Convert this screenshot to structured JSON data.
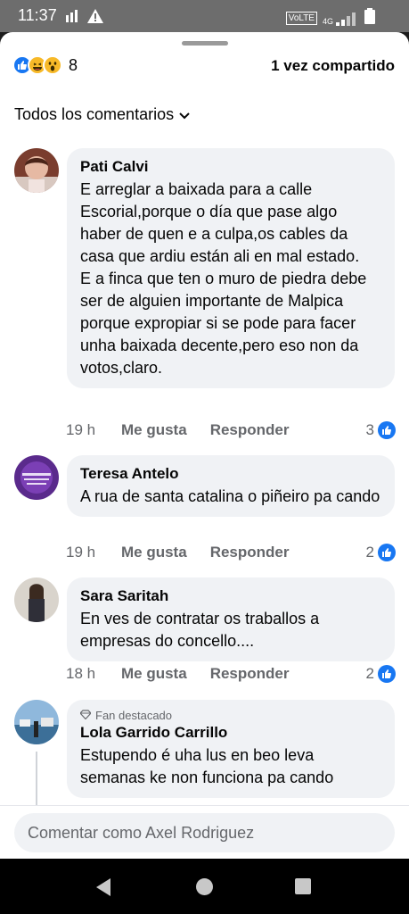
{
  "status_bar": {
    "time": "11:37",
    "network_label": "VoLTE",
    "signal_label": "4G"
  },
  "reactions": {
    "types": [
      "like-icon",
      "haha-icon",
      "wow-icon"
    ],
    "count": "8"
  },
  "shares_text": "1 vez compartido",
  "filter_label": "Todos los comentarios",
  "comments": [
    {
      "author": "Pati Calvi",
      "lines": [
        "E arreglar a baixada para a calle Escorial,porque o día que pase algo haber de quen e a culpa,os cables da casa que ardiu están ali en mal estado.",
        "E a finca que ten o muro de piedra debe ser de alguien importante de Malpica porque expropiar si se pode para facer unha baixada decente,pero eso non da votos,claro."
      ],
      "time": "19 h",
      "like_label": "Me gusta",
      "reply_label": "Responder",
      "likes": "3"
    },
    {
      "author": "Teresa Antelo",
      "lines": [
        "A rua de santa catalina o piñeiro pa cando"
      ],
      "time": "19 h",
      "like_label": "Me gusta",
      "reply_label": "Responder",
      "likes": "2"
    },
    {
      "author": "Sara Saritah",
      "lines": [
        "En ves de contratar os traballos a empresas do concello...."
      ],
      "time": "18 h",
      "like_label": "Me gusta",
      "reply_label": "Responder",
      "likes": "2"
    },
    {
      "badge": "Fan destacado",
      "author": "Lola Garrido Carrillo",
      "lines": [
        "Estupendo é uha lus en beo leva semanas ke non funciona pa cando"
      ]
    }
  ],
  "compose_placeholder": "Comentar como Axel Rodriguez",
  "colors": {
    "accent": "#1877f2",
    "bubble": "#f0f2f5",
    "secondary_text": "#65676b"
  }
}
